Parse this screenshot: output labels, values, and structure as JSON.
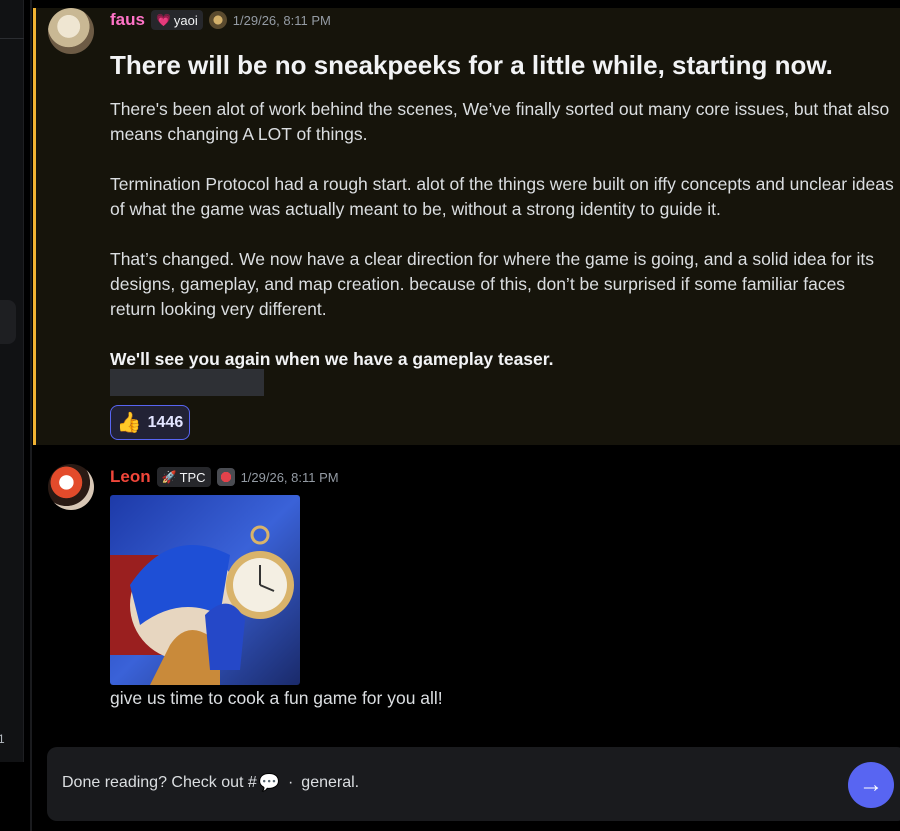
{
  "sidebar": {
    "badge_count": "1"
  },
  "messages": [
    {
      "username": "faus",
      "tag": {
        "icon": "heart-icon",
        "glyph": "💗",
        "label": "yaoi"
      },
      "role_icon": "guild-badge-icon",
      "timestamp": "1/29/26, 8:11 PM",
      "highlighted": true,
      "heading": "There will be no sneakpeeks for a little while, starting now.",
      "paragraphs": [
        "There's been alot of work behind the scenes, We’ve finally sorted out many core issues, but that also means changing A LOT of things.",
        "Termination Protocol had a rough start. alot of the things were built on iffy concepts and unclear ideas of what the game was actually meant to be, without a strong identity to guide it.",
        "That’s changed. We now have a clear direction for where the game is going, and a solid idea for its designs, gameplay, and map creation. because of this, don’t be surprised if some familiar faces return looking very different."
      ],
      "closing": "We'll see you again when we have a gameplay teaser.",
      "reaction": {
        "emoji": "👍",
        "count": "1446"
      }
    },
    {
      "username": "Leon",
      "tag": {
        "icon": "rocket-icon",
        "glyph": "🚀",
        "label": "TPC"
      },
      "role_icon": "guild-badge-icon",
      "timestamp": "1/29/26, 8:11 PM",
      "text": "give us time to cook a fun game for you all!"
    }
  ],
  "composer": {
    "prefix": "Done reading? Check out #",
    "channel_icon": "💬",
    "separator": "·",
    "channel_name": "general."
  },
  "send_icon": "→",
  "colors": {
    "accent": "#5865f2",
    "mention_border": "#f0b232",
    "faus_name": "#ff73c7",
    "leon_name": "#f0463a"
  }
}
